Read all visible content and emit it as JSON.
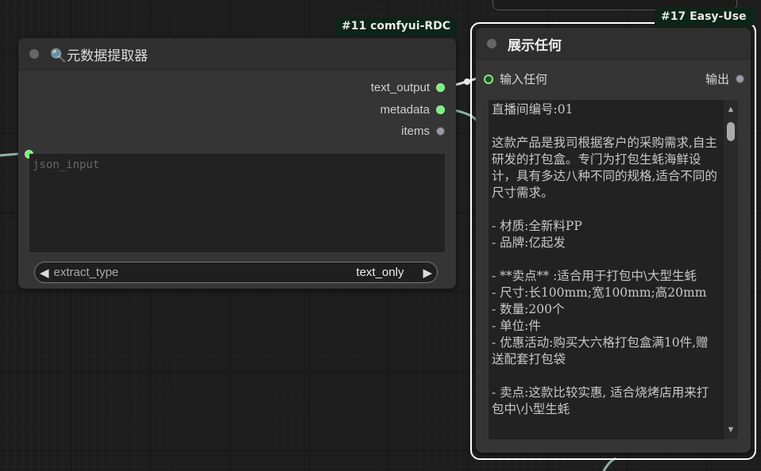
{
  "node11": {
    "badge": "#11 comfyui-RDC",
    "title": "🔍元数据提取器",
    "outputs": [
      {
        "label": "text_output",
        "color": "green"
      },
      {
        "label": "metadata",
        "color": "green"
      },
      {
        "label": "items",
        "color": "grey"
      }
    ],
    "json_input_placeholder": "json_input",
    "combo": {
      "name": "extract_type",
      "value": "text_only"
    }
  },
  "node17": {
    "badge": "#17 Easy-Use",
    "title": "展示任何",
    "input_label": "输入任何",
    "output_label": "输出",
    "text": "直播间编号:01\n\n这款产品是我司根据客户的采购需求,自主研发的打包盒。专门为打包生蚝海鲜设计，具有多达八种不同的规格,适合不同的尺寸需求。\n\n- 材质:全新料PP\n- 品牌:亿起发\n\n- **卖点** :适合用于打包中\\大型生蚝\n- 尺寸:长100mm;宽100mm;高20mm\n- 数量:200个\n- 单位:件\n- 优惠活动:购买大六格打包盒满10件,赠送配套打包袋\n\n- 卖点:这款比较实惠, 适合烧烤店用来打包中\\小型生蚝"
  },
  "colors": {
    "link": "#d8d8d8",
    "link_teal": "#8fb3a6",
    "slot_green": "#7cf07c",
    "badge_bg": "#0c2419",
    "selected_outline": "#ffffff"
  },
  "icons": {
    "up": "▲",
    "down": "▼",
    "left": "◀",
    "right": "▶"
  }
}
